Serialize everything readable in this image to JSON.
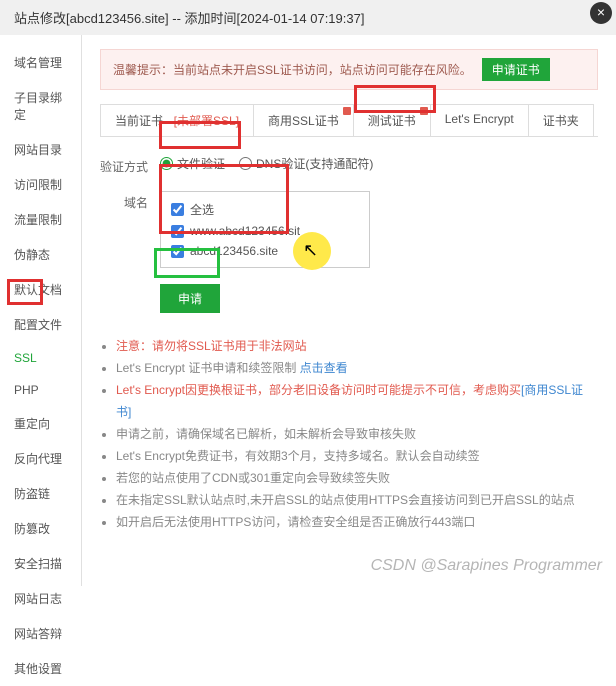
{
  "header": {
    "title": "站点修改[abcd123456.site] -- 添加时间[2024-01-14 07:19:37]",
    "close": "×"
  },
  "sidebar": {
    "items": [
      {
        "label": "域名管理"
      },
      {
        "label": "子目录绑定"
      },
      {
        "label": "网站目录"
      },
      {
        "label": "访问限制"
      },
      {
        "label": "流量限制"
      },
      {
        "label": "伪静态"
      },
      {
        "label": "默认文档"
      },
      {
        "label": "配置文件"
      },
      {
        "label": "SSL"
      },
      {
        "label": "PHP"
      },
      {
        "label": "重定向"
      },
      {
        "label": "反向代理"
      },
      {
        "label": "防盗链"
      },
      {
        "label": "防篡改"
      },
      {
        "label": "安全扫描"
      },
      {
        "label": "网站日志"
      },
      {
        "label": "网站答辩"
      },
      {
        "label": "其他设置"
      }
    ]
  },
  "alert": {
    "prefix": "温馨提示：",
    "text": "当前站点未开启SSL证书访问，站点访问可能存在风险。",
    "button": "申请证书"
  },
  "tabs": {
    "items": [
      {
        "label": "当前证书 - ",
        "suffix": "[未部署SSL]"
      },
      {
        "label": "商用SSL证书"
      },
      {
        "label": "测试证书"
      },
      {
        "label": "Let's Encrypt"
      },
      {
        "label": "证书夹"
      }
    ]
  },
  "form": {
    "verify_label": "验证方式",
    "verify_file": "文件验证",
    "verify_dns": "DNS验证(支持通配符)",
    "domain_label": "域名",
    "select_all": "全选",
    "domain1": "www.abcd123456.sit",
    "domain2": "abcd123456.site",
    "apply": "申请"
  },
  "notes": {
    "n1a": "注意：请勿将SSL证书用于非法网站",
    "n2a": "Let's Encrypt 证书申请和续签限制 ",
    "n2b": "点击查看",
    "n3a": "Let's Encrypt因更换根证书，部分老旧设备访问时可能提示不可信，考虑购买",
    "n3b": "[商用SSL证书]",
    "n4": "申请之前，请确保域名已解析，如未解析会导致审核失败",
    "n5": "Let's Encrypt免费证书，有效期3个月，支持多域名。默认会自动续签",
    "n6": "若您的站点使用了CDN或301重定向会导致续签失败",
    "n7": "在未指定SSL默认站点时,未开启SSL的站点使用HTTPS会直接访问到已开启SSL的站点",
    "n8": "如开启后无法使用HTTPS访问，请检查安全组是否正确放行443端口"
  },
  "watermark": "CSDN @Sarapines Programmer"
}
